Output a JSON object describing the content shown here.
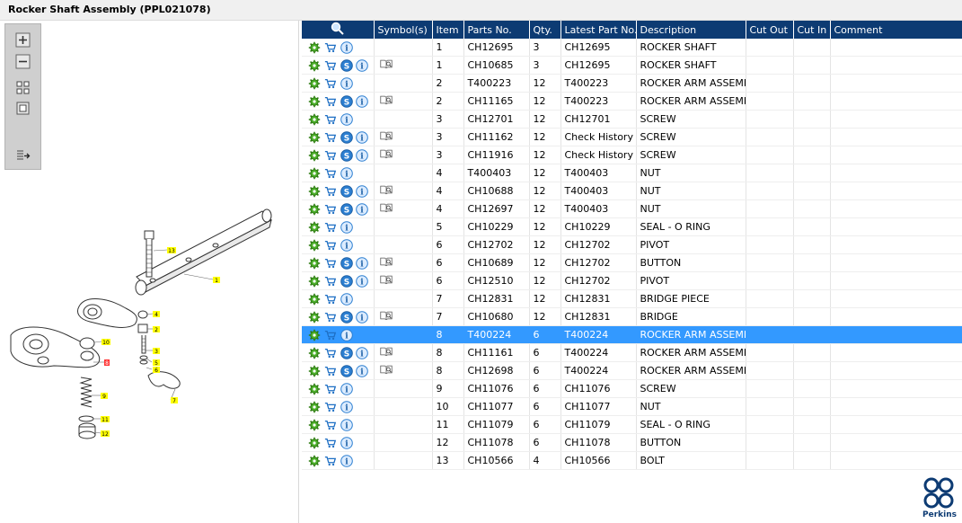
{
  "window": {
    "title": "Rocker Shaft Assembly (PPL021078)"
  },
  "toolbar": {
    "buttons": [
      {
        "name": "zoom-in-button",
        "icon": "plus-icon"
      },
      {
        "name": "zoom-out-button",
        "icon": "minus-icon"
      },
      {
        "name": "fit-all-button",
        "icon": "fit-icon"
      },
      {
        "name": "actual-size-button",
        "icon": "square-icon"
      },
      {
        "name": "export-list-button",
        "icon": "list-arrow-icon"
      }
    ]
  },
  "diagram": {
    "callouts": [
      "13",
      "1",
      "4",
      "2",
      "10",
      "3",
      "8",
      "5",
      "6",
      "9",
      "7",
      "11",
      "12"
    ]
  },
  "grid": {
    "headers": [
      "Symbol(s)",
      "Item",
      "Parts No.",
      "Qty.",
      "Latest Part No.",
      "Description",
      "Cut Out",
      "Cut In",
      "Comment"
    ],
    "rows": [
      {
        "s": false,
        "sym": false,
        "item": "1",
        "part": "CH12695",
        "qty": "3",
        "latest": "CH12695",
        "desc": "ROCKER SHAFT"
      },
      {
        "s": true,
        "sym": true,
        "item": "1",
        "part": "CH10685",
        "qty": "3",
        "latest": "CH12695",
        "desc": "ROCKER SHAFT"
      },
      {
        "s": false,
        "sym": false,
        "item": "2",
        "part": "T400223",
        "qty": "12",
        "latest": "T400223",
        "desc": "ROCKER ARM ASSEMBL"
      },
      {
        "s": true,
        "sym": true,
        "item": "2",
        "part": "CH11165",
        "qty": "12",
        "latest": "T400223",
        "desc": "ROCKER ARM ASSEMBL"
      },
      {
        "s": false,
        "sym": false,
        "item": "3",
        "part": "CH12701",
        "qty": "12",
        "latest": "CH12701",
        "desc": "SCREW"
      },
      {
        "s": true,
        "sym": true,
        "item": "3",
        "part": "CH11162",
        "qty": "12",
        "latest": "Check History",
        "desc": "SCREW"
      },
      {
        "s": true,
        "sym": true,
        "item": "3",
        "part": "CH11916",
        "qty": "12",
        "latest": "Check History",
        "desc": "SCREW"
      },
      {
        "s": false,
        "sym": false,
        "item": "4",
        "part": "T400403",
        "qty": "12",
        "latest": "T400403",
        "desc": "NUT"
      },
      {
        "s": true,
        "sym": true,
        "item": "4",
        "part": "CH10688",
        "qty": "12",
        "latest": "T400403",
        "desc": "NUT"
      },
      {
        "s": true,
        "sym": true,
        "item": "4",
        "part": "CH12697",
        "qty": "12",
        "latest": "T400403",
        "desc": "NUT"
      },
      {
        "s": false,
        "sym": false,
        "item": "5",
        "part": "CH10229",
        "qty": "12",
        "latest": "CH10229",
        "desc": "SEAL - O RING"
      },
      {
        "s": false,
        "sym": false,
        "item": "6",
        "part": "CH12702",
        "qty": "12",
        "latest": "CH12702",
        "desc": "PIVOT"
      },
      {
        "s": true,
        "sym": true,
        "item": "6",
        "part": "CH10689",
        "qty": "12",
        "latest": "CH12702",
        "desc": "BUTTON"
      },
      {
        "s": true,
        "sym": true,
        "item": "6",
        "part": "CH12510",
        "qty": "12",
        "latest": "CH12702",
        "desc": "PIVOT"
      },
      {
        "s": false,
        "sym": false,
        "item": "7",
        "part": "CH12831",
        "qty": "12",
        "latest": "CH12831",
        "desc": "BRIDGE PIECE"
      },
      {
        "s": true,
        "sym": true,
        "item": "7",
        "part": "CH10680",
        "qty": "12",
        "latest": "CH12831",
        "desc": "BRIDGE"
      },
      {
        "s": false,
        "sym": false,
        "item": "8",
        "part": "T400224",
        "qty": "6",
        "latest": "T400224",
        "desc": "ROCKER ARM ASSEMBL",
        "selected": true
      },
      {
        "s": true,
        "sym": true,
        "item": "8",
        "part": "CH11161",
        "qty": "6",
        "latest": "T400224",
        "desc": "ROCKER ARM ASSEMBL"
      },
      {
        "s": true,
        "sym": true,
        "item": "8",
        "part": "CH12698",
        "qty": "6",
        "latest": "T400224",
        "desc": "ROCKER ARM ASSEMBL"
      },
      {
        "s": false,
        "sym": false,
        "item": "9",
        "part": "CH11076",
        "qty": "6",
        "latest": "CH11076",
        "desc": "SCREW"
      },
      {
        "s": false,
        "sym": false,
        "item": "10",
        "part": "CH11077",
        "qty": "6",
        "latest": "CH11077",
        "desc": "NUT"
      },
      {
        "s": false,
        "sym": false,
        "item": "11",
        "part": "CH11079",
        "qty": "6",
        "latest": "CH11079",
        "desc": "SEAL - O RING"
      },
      {
        "s": false,
        "sym": false,
        "item": "12",
        "part": "CH11078",
        "qty": "6",
        "latest": "CH11078",
        "desc": "BUTTON"
      },
      {
        "s": false,
        "sym": false,
        "item": "13",
        "part": "CH10566",
        "qty": "4",
        "latest": "CH10566",
        "desc": "BOLT"
      }
    ]
  },
  "logo": {
    "text": "Perkins"
  },
  "colors": {
    "header": "#0d3b73",
    "selected": "#3399ff",
    "callout": "#ffff00",
    "callout_selected": "#ff3333"
  }
}
